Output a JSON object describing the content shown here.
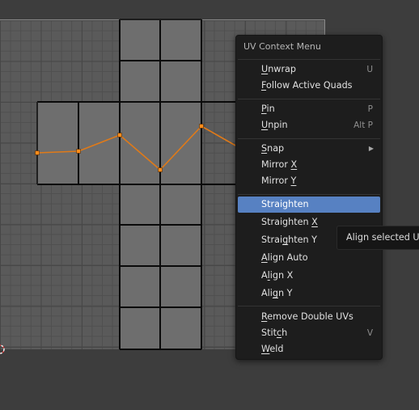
{
  "menu": {
    "title": "UV Context Menu",
    "items": [
      {
        "u": "U",
        "rest": "nwrap",
        "shortcut": "U"
      },
      {
        "u": "F",
        "rest": "ollow Active Quads",
        "shortcut": ""
      },
      {
        "u": "P",
        "rest": "in",
        "shortcut": "P"
      },
      {
        "u": "U",
        "rest": "npin",
        "shortcut": "Alt P"
      },
      {
        "u": "S",
        "rest": "nap",
        "shortcut": ""
      },
      {
        "pre": "Mirror ",
        "u": "X",
        "rest": "",
        "shortcut": ""
      },
      {
        "pre": "Mirror ",
        "u": "Y",
        "rest": "",
        "shortcut": ""
      },
      {
        "pre": "Straighten",
        "u": "",
        "rest": "",
        "shortcut": ""
      },
      {
        "pre": "Straighten ",
        "u": "X",
        "rest": "",
        "shortcut": ""
      },
      {
        "pre": "Strai",
        "u": "g",
        "rest": "hten Y",
        "shortcut": ""
      },
      {
        "u": "A",
        "rest": "lign Auto",
        "shortcut": ""
      },
      {
        "pre": "A",
        "u": "l",
        "rest": "ign X",
        "shortcut": ""
      },
      {
        "pre": "Ali",
        "u": "g",
        "rest": "n Y",
        "shortcut": ""
      },
      {
        "u": "R",
        "rest": "emove Double UVs",
        "shortcut": ""
      },
      {
        "pre": "Stit",
        "u": "c",
        "rest": "h",
        "shortcut": "V"
      },
      {
        "u": "W",
        "rest": "eld",
        "shortcut": ""
      }
    ]
  },
  "tooltip": {
    "text": "Align selected UV"
  },
  "colors": {
    "accent": "#5781c2",
    "selected_edge": "#ff8c1a",
    "menu_bg": "#1d1d1d",
    "grid_bg": "#5a5a5a"
  }
}
